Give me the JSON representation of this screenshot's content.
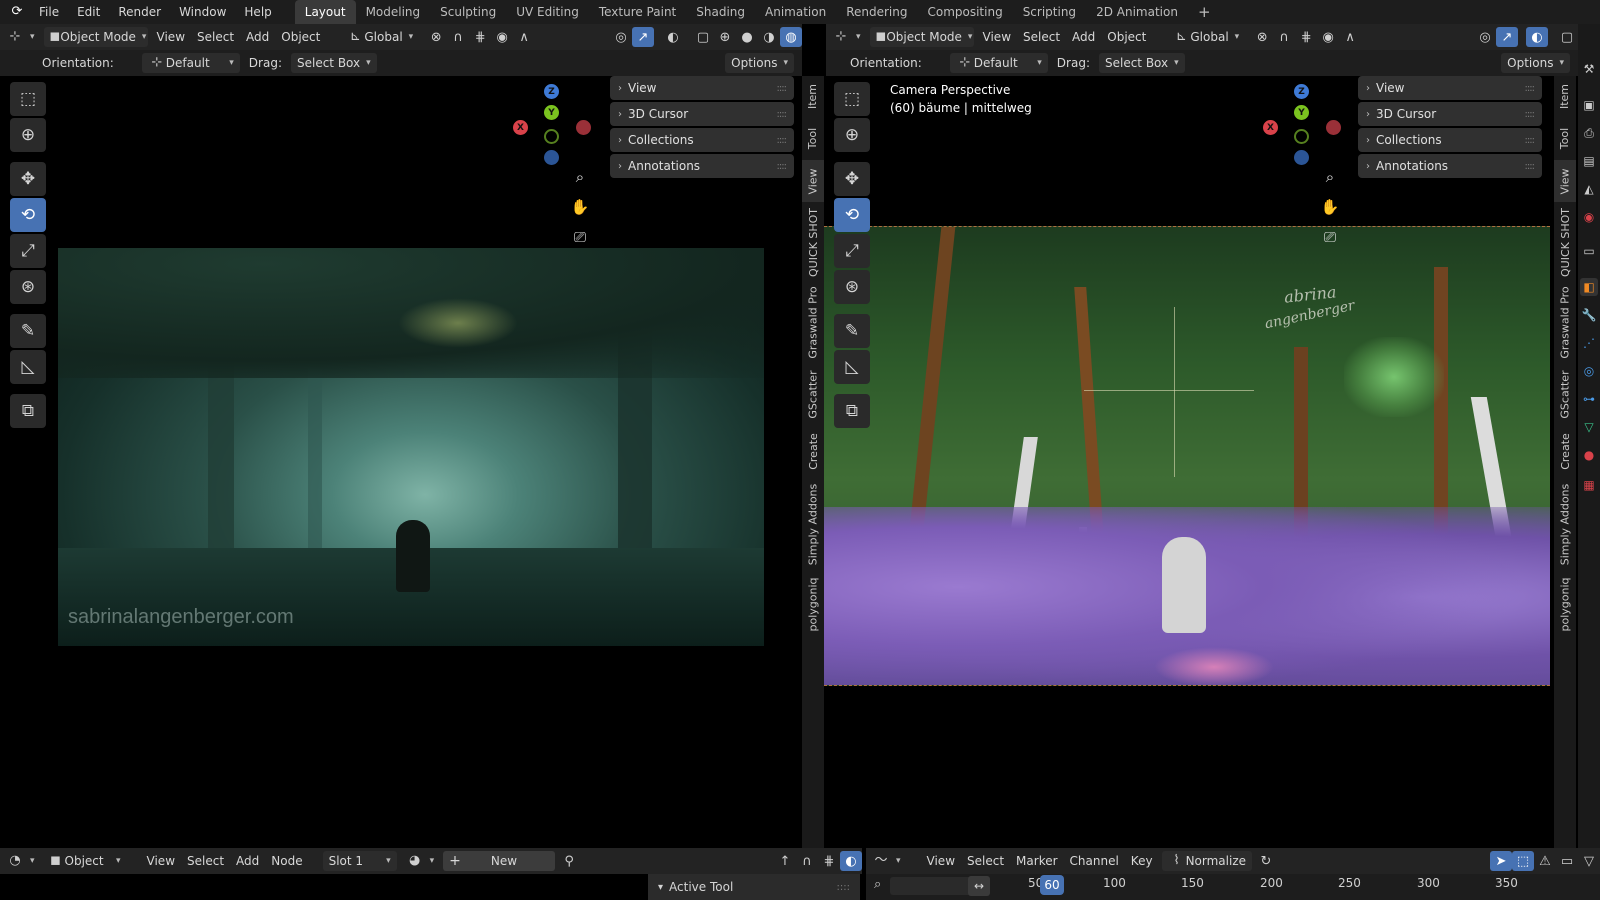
{
  "topbar": {
    "menus": [
      "File",
      "Edit",
      "Render",
      "Window",
      "Help"
    ],
    "workspaces": [
      "Layout",
      "Modeling",
      "Sculpting",
      "UV Editing",
      "Texture Paint",
      "Shading",
      "Animation",
      "Rendering",
      "Compositing",
      "Scripting",
      "2D Animation"
    ],
    "active_workspace": "Layout",
    "add_tab_icon": "plus-icon"
  },
  "left_viewport": {
    "header": {
      "mode": "Object Mode",
      "menus": [
        "View",
        "Select",
        "Add",
        "Object"
      ],
      "transform_orientation": "Global"
    },
    "tool_settings": {
      "orientation_label": "Orientation:",
      "orientation_value": "Default",
      "drag_label": "Drag:",
      "drag_value": "Select Box",
      "options_label": "Options"
    },
    "npanel": [
      "View",
      "3D Cursor",
      "Collections",
      "Annotations"
    ],
    "watermark": "sabrinalangenberger.com",
    "gizmo": {
      "z": "Z",
      "y": "Y",
      "x": "X"
    }
  },
  "right_viewport": {
    "header": {
      "mode": "Object Mode",
      "menus": [
        "View",
        "Select",
        "Add",
        "Object"
      ],
      "transform_orientation": "Global"
    },
    "tool_settings": {
      "orientation_label": "Orientation:",
      "orientation_value": "Default",
      "drag_label": "Drag:",
      "drag_value": "Select Box",
      "options_label": "Options"
    },
    "overlay_title": "Camera Perspective",
    "overlay_subtitle": "(60) bäume | mittelweg",
    "npanel": [
      "View",
      "3D Cursor",
      "Collections",
      "Annotations"
    ],
    "gizmo": {
      "z": "Z",
      "y": "Y",
      "x": "X"
    }
  },
  "side_tabs": [
    "Item",
    "Tool",
    "View",
    "QUICK SHOT",
    "Graswald Pro",
    "GScatter",
    "Create",
    "Simply Addons",
    "polygoniq"
  ],
  "side_tabs_active": "View",
  "shader_editor": {
    "object_label": "Object",
    "menus": [
      "View",
      "Select",
      "Add",
      "Node"
    ],
    "slot_label": "Slot 1",
    "new_label": "New",
    "active_tool_label": "Active Tool"
  },
  "timeline": {
    "menus": [
      "View",
      "Select",
      "Marker",
      "Channel",
      "Key"
    ],
    "normalize_label": "Normalize",
    "current_frame": "60",
    "left_partial": "50",
    "ticks": [
      "100",
      "150",
      "200",
      "250",
      "300",
      "350"
    ]
  },
  "signature": {
    "line1": "abrina",
    "line2": "angenberger"
  },
  "colors": {
    "accent": "#4772b3",
    "axis_x": "#d9424a",
    "axis_y": "#7bc41f",
    "axis_z": "#3e7ad6"
  }
}
